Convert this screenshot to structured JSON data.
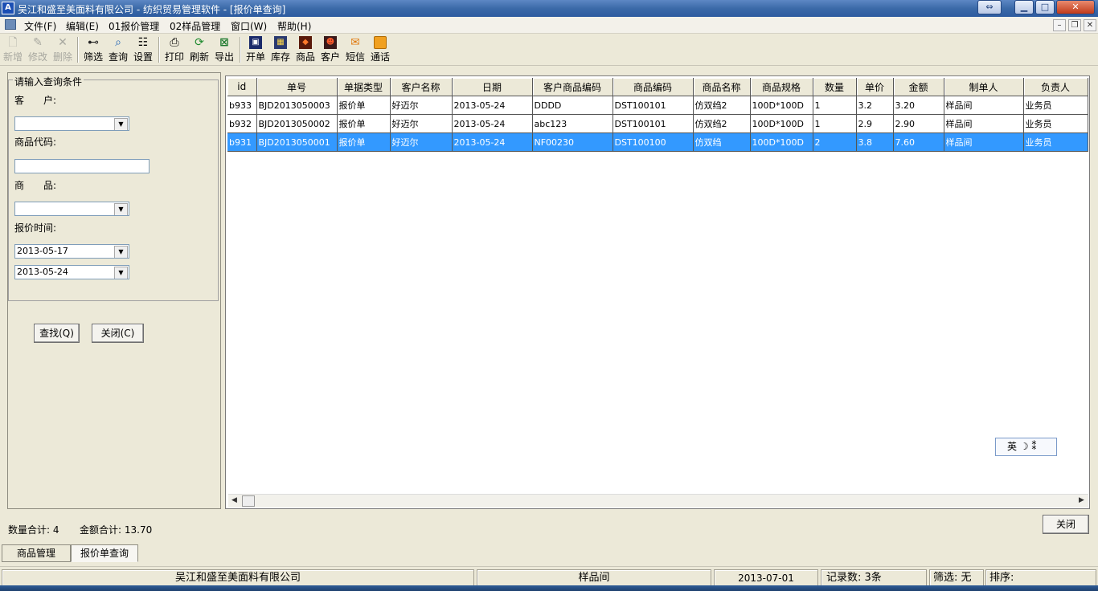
{
  "window": {
    "title": "吴江和盛至美面料有限公司 - 纺织贸易管理软件 - [报价单查询]",
    "app_icon": "A"
  },
  "menu": {
    "items": [
      "文件(F)",
      "编辑(E)",
      "01报价管理",
      "02样品管理",
      "窗口(W)",
      "帮助(H)"
    ]
  },
  "toolbar": {
    "items": [
      {
        "label": "新增",
        "icon": "new-doc-icon",
        "enabled": false
      },
      {
        "label": "修改",
        "icon": "edit-icon",
        "enabled": false
      },
      {
        "label": "删除",
        "icon": "delete-icon",
        "enabled": false
      },
      {
        "label": "筛选",
        "icon": "binoculars-icon",
        "enabled": true
      },
      {
        "label": "查询",
        "icon": "search-icon",
        "enabled": true
      },
      {
        "label": "设置",
        "icon": "settings-icon",
        "enabled": true
      },
      {
        "label": "打印",
        "icon": "printer-icon",
        "enabled": true
      },
      {
        "label": "刷新",
        "icon": "refresh-icon",
        "enabled": true
      },
      {
        "label": "导出",
        "icon": "excel-export-icon",
        "enabled": true
      },
      {
        "label": "开单",
        "icon": "open-order-icon",
        "enabled": true
      },
      {
        "label": "库存",
        "icon": "inventory-icon",
        "enabled": true
      },
      {
        "label": "商品",
        "icon": "product-icon",
        "enabled": true
      },
      {
        "label": "客户",
        "icon": "customer-icon",
        "enabled": true
      },
      {
        "label": "短信",
        "icon": "sms-icon",
        "enabled": true
      },
      {
        "label": "通话",
        "icon": "call-icon",
        "enabled": true
      }
    ]
  },
  "query": {
    "group_title": "请输入查询条件",
    "customer_label": "客　　户:",
    "customer_value": "",
    "product_code_label": "商品代码:",
    "product_code_value": "",
    "product_label": "商　　品:",
    "product_value": "",
    "date_label": "报价时间:",
    "date_from": "2013-05-17",
    "date_to": "2013-05-24",
    "find_button": "查找(Q)",
    "close_button": "关闭(C)"
  },
  "grid": {
    "columns": [
      "id",
      "单号",
      "单据类型",
      "客户名称",
      "日期",
      "客户商品编码",
      "商品编码",
      "商品名称",
      "商品规格",
      "数量",
      "单价",
      "金额",
      "制单人",
      "负责人"
    ],
    "rows": [
      [
        "b933",
        "BJD2013050003",
        "报价单",
        "好迈尔",
        "2013-05-24",
        "DDDD",
        "DST100101",
        "仿双绉2",
        "100D*100D",
        "1",
        "3.2",
        "3.20",
        "样品间",
        "业务员"
      ],
      [
        "b932",
        "BJD2013050002",
        "报价单",
        "好迈尔",
        "2013-05-24",
        "abc123",
        "DST100101",
        "仿双绉2",
        "100D*100D",
        "1",
        "2.9",
        "2.90",
        "样品间",
        "业务员"
      ],
      [
        "b931",
        "BJD2013050001",
        "报价单",
        "好迈尔",
        "2013-05-24",
        "NF00230",
        "DST100100",
        "仿双绉",
        "100D*100D",
        "2",
        "3.8",
        "7.60",
        "样品间",
        "业务员"
      ]
    ],
    "selected_row": 2
  },
  "ime": {
    "text": "英 ☽ ⁑"
  },
  "totals": {
    "qty": "数量合计: 4",
    "amount": "金额合计: 13.70"
  },
  "close_button": "关闭",
  "tabs": [
    "商品管理",
    "报价单查询"
  ],
  "status": {
    "company": "吴江和盛至美面料有限公司",
    "user": "样品间",
    "date": "2013-07-01",
    "records": "记录数: 3条",
    "filter": "筛选: 无",
    "sort": "排序:"
  }
}
